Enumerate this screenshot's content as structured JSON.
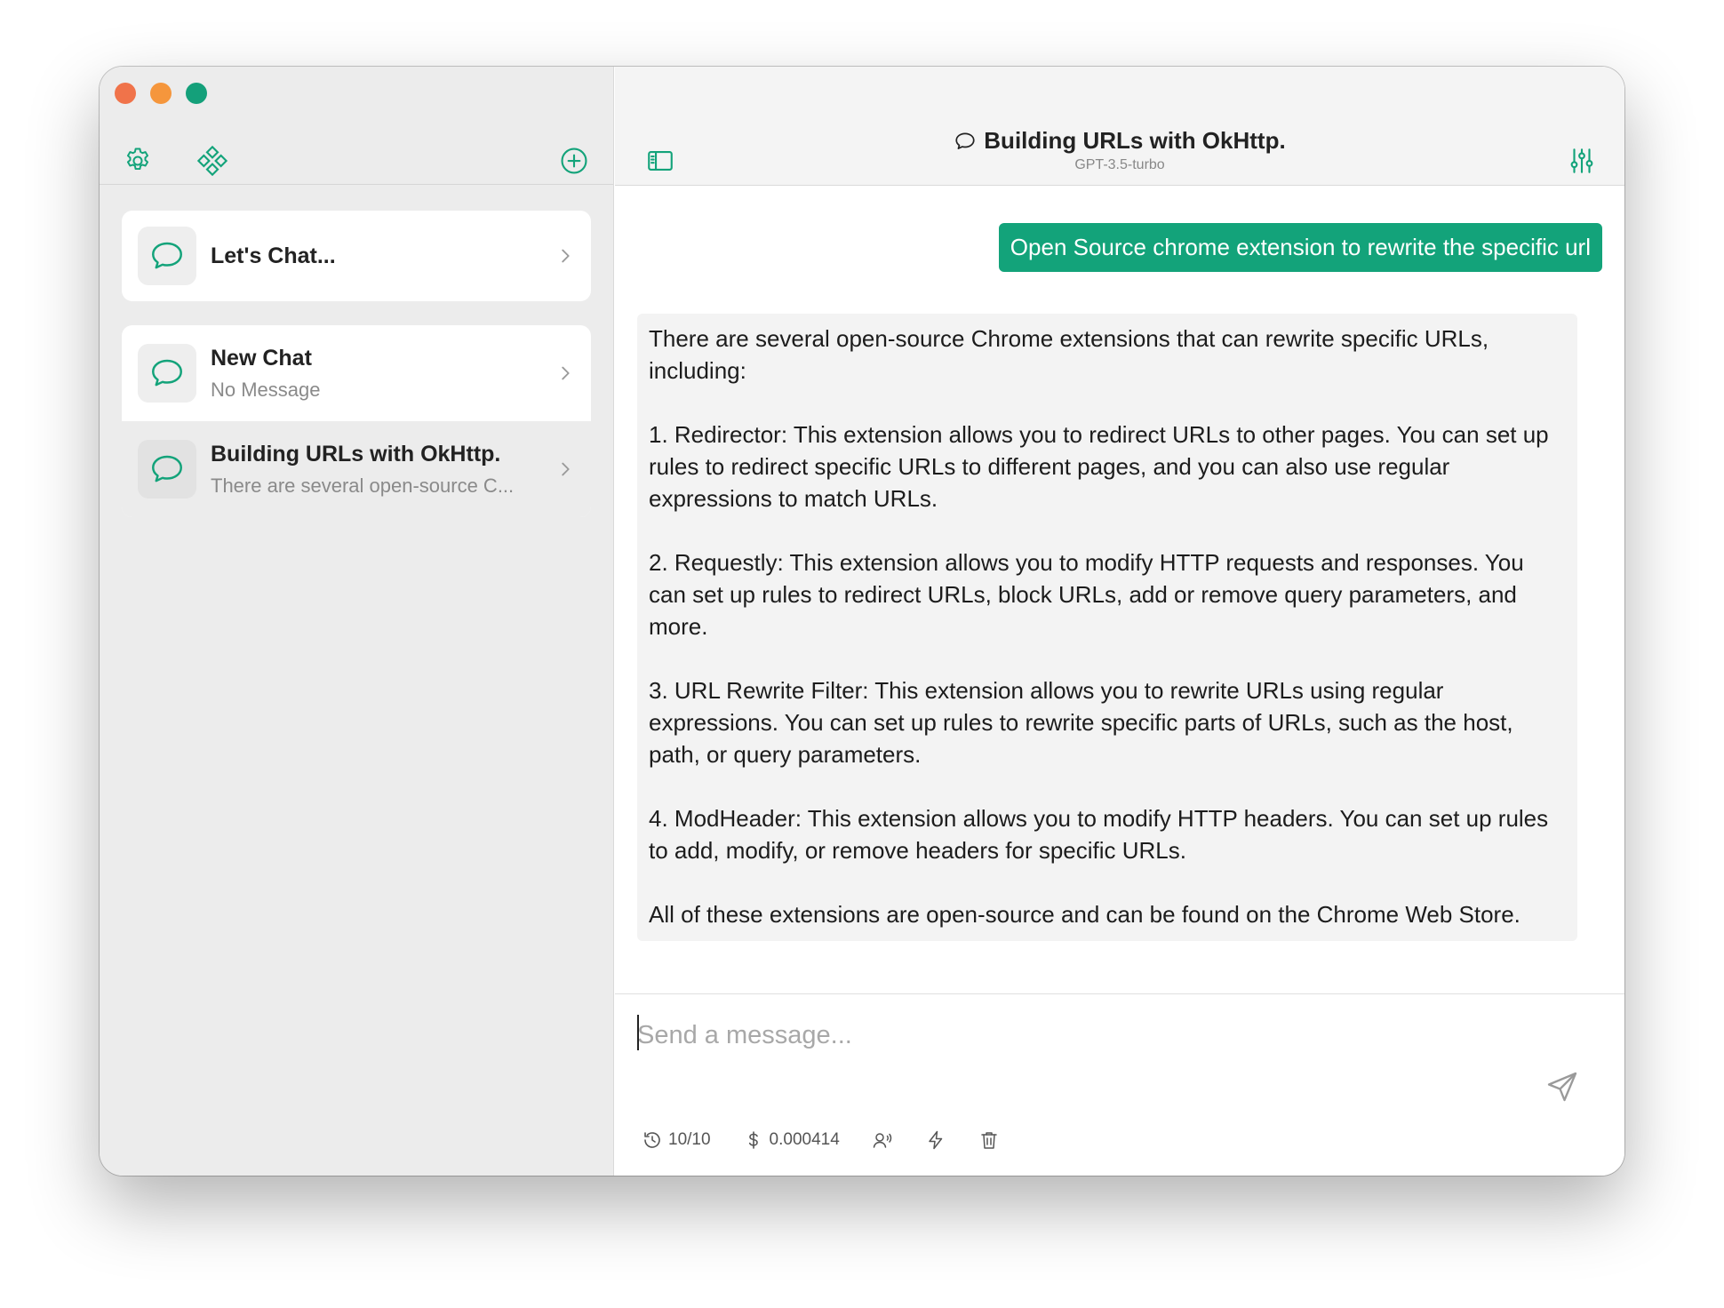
{
  "window": {
    "traffic_lights": {
      "close": "#f0734a",
      "minimize": "#f5963c",
      "zoom": "#14a07a"
    }
  },
  "sidebar": {
    "toolbar": {
      "icons": [
        "gear-icon",
        "diamond-grid-icon",
        "plus-circle-icon"
      ]
    },
    "chats": [
      {
        "title": "Let's Chat...",
        "subtitle": ""
      },
      {
        "title": "New Chat",
        "subtitle": "No Message"
      },
      {
        "title": "Building URLs with OkHttp.",
        "subtitle": "There are several open-source C...",
        "selected": true
      }
    ]
  },
  "header": {
    "title": "Building URLs with OkHttp.",
    "model": "GPT-3.5-turbo",
    "icons": [
      "sidebar-toggle-icon",
      "chat-bubble-icon",
      "sliders-icon"
    ]
  },
  "conversation": {
    "user_message": "Open Source chrome extension to rewrite the specific url",
    "assistant_message": "There are several open-source Chrome extensions that can rewrite specific URLs, including:\n\n1. Redirector: This extension allows you to redirect URLs to other pages. You can set up rules to redirect specific URLs to different pages, and you can also use regular expressions to match URLs.\n\n2. Requestly: This extension allows you to modify HTTP requests and responses. You can set up rules to redirect URLs, block URLs, add or remove query parameters, and more.\n\n3. URL Rewrite Filter: This extension allows you to rewrite URLs using regular expressions. You can set up rules to rewrite specific parts of URLs, such as the host, path, or query parameters.\n\n4. ModHeader: This extension allows you to modify HTTP headers. You can set up rules to add, modify, or remove headers for specific URLs.\n\nAll of these extensions are open-source and can be found on the Chrome Web Store."
  },
  "composer": {
    "placeholder": "Send a message...",
    "value": ""
  },
  "status": {
    "history": "10/10",
    "cost": "0.000414",
    "icons": [
      "history-icon",
      "dollar-icon",
      "voice-icon",
      "lightning-icon",
      "trash-icon"
    ]
  },
  "colors": {
    "accent": "#13a37a",
    "sidebar_bg": "#ececec",
    "header_bg": "#f4f4f4",
    "assistant_bubble": "#f3f3f3"
  }
}
